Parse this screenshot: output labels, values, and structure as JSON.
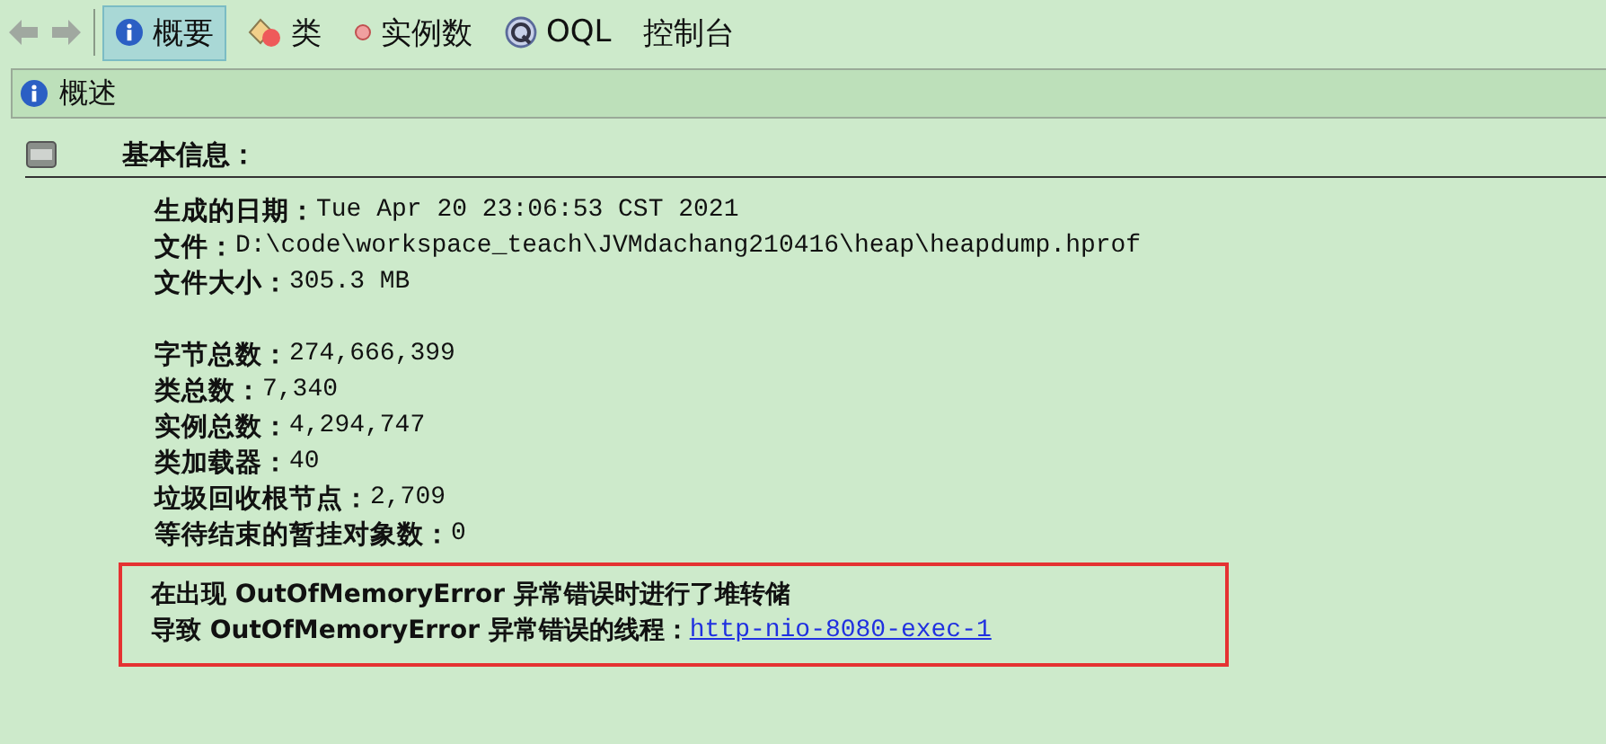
{
  "toolbar": {
    "tabs": [
      {
        "label": "概要",
        "kind": "info",
        "selected": true
      },
      {
        "label": "类",
        "kind": "class",
        "selected": false
      },
      {
        "label": "实例数",
        "kind": "instance",
        "selected": false
      },
      {
        "label": "OQL",
        "kind": "oql",
        "selected": false
      },
      {
        "label": "控制台",
        "kind": "console",
        "selected": false
      }
    ]
  },
  "panel": {
    "title": "概述"
  },
  "section": {
    "title": "基本信息："
  },
  "groups": [
    [
      {
        "label": "生成的日期：",
        "value": "Tue Apr 20 23:06:53 CST 2021"
      },
      {
        "label": "文件：",
        "value": "D:\\code\\workspace_teach\\JVMdachang210416\\heap\\heapdump.hprof"
      },
      {
        "label": "文件大小：",
        "value": "305.3 MB"
      }
    ],
    [
      {
        "label": "字节总数：",
        "value": "274,666,399"
      },
      {
        "label": "类总数：",
        "value": "7,340"
      },
      {
        "label": "实例总数：",
        "value": "4,294,747"
      },
      {
        "label": "类加载器：",
        "value": "40"
      },
      {
        "label": "垃圾回收根节点：",
        "value": "2,709"
      },
      {
        "label": "等待结束的暂挂对象数：",
        "value": "0"
      }
    ]
  ],
  "notice": [
    {
      "text": "在出现 OutOfMemoryError 异常错误时进行了堆转储"
    },
    {
      "text": "导致 OutOfMemoryError 异常错误的线程：",
      "link": "http-nio-8080-exec-1"
    }
  ]
}
